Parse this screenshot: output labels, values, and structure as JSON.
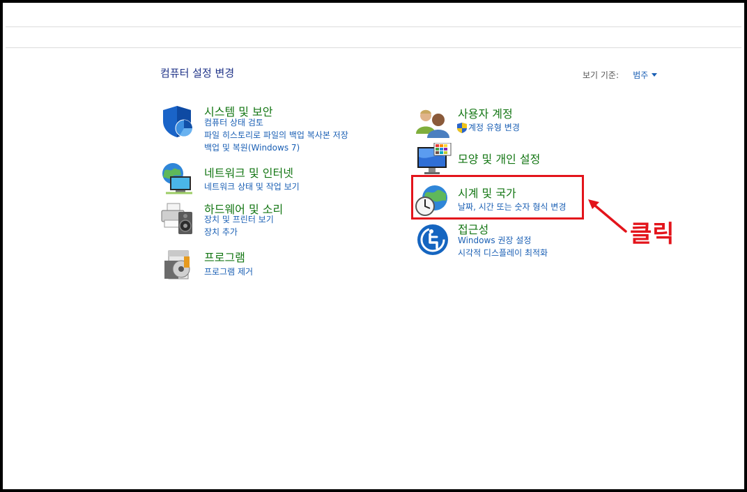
{
  "header": {
    "title": "컴퓨터 설정 변경",
    "view_by_label": "보기 기준:",
    "view_by_value": "범주"
  },
  "categories": {
    "system": {
      "title": "시스템 및 보안",
      "icon": "shield-icon",
      "links": [
        "컴퓨터 상태 검토",
        "파일 히스토리로 파일의 백업 복사본 저장",
        "백업 및 복원(Windows 7)"
      ]
    },
    "network": {
      "title": "네트워크 및 인터넷",
      "icon": "network-globe-icon",
      "links": [
        "네트워크 상태 및 작업 보기"
      ]
    },
    "hardware": {
      "title": "하드웨어 및 소리",
      "icon": "printer-speaker-icon",
      "links": [
        "장치 및 프린터 보기",
        "장치 추가"
      ]
    },
    "programs": {
      "title": "프로그램",
      "icon": "programs-icon",
      "links": [
        "프로그램 제거"
      ]
    },
    "user_accounts": {
      "title": "사용자 계정",
      "icon": "users-icon",
      "links": [
        "계정 유형 변경"
      ]
    },
    "appearance": {
      "title": "모양 및 개인 설정",
      "icon": "monitor-palette-icon",
      "links": []
    },
    "clock_region": {
      "title": "시계 및 국가",
      "icon": "clock-globe-icon",
      "links": [
        "날짜, 시간 또는 숫자 형식 변경"
      ]
    },
    "ease_of_access": {
      "title": "접근성",
      "icon": "ease-of-access-icon",
      "links": [
        "Windows 권장 설정",
        "시각적 디스플레이 최적화"
      ]
    }
  },
  "annotation": {
    "label": "클릭",
    "color": "#e3141b"
  }
}
